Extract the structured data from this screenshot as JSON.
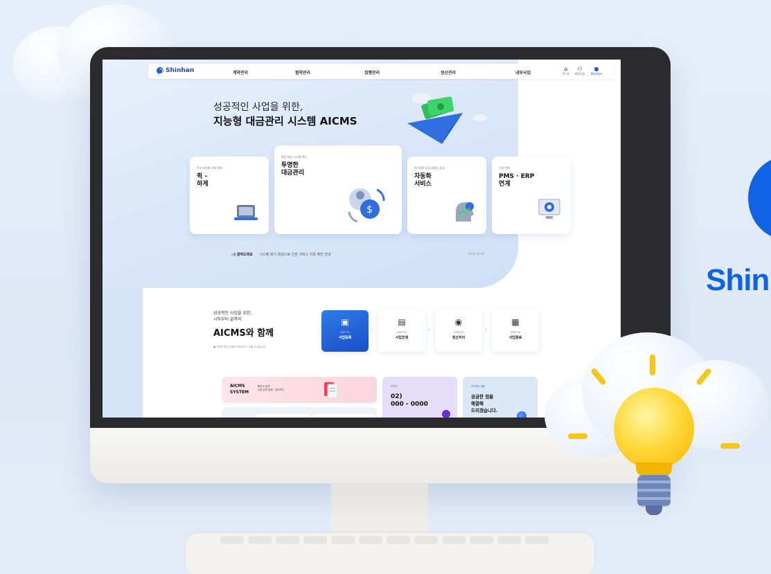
{
  "nav": {
    "logo": "Shinhan",
    "items": [
      "계약관리",
      "협약관리",
      "집행관리",
      "정산관리",
      "내부사업"
    ],
    "utils": [
      {
        "icon": "lock-icon",
        "label": "로그인"
      },
      {
        "icon": "user-icon",
        "label": "회원가입"
      },
      {
        "icon": "shinhan-logo-icon",
        "label": "Shinhan"
      }
    ]
  },
  "hero": {
    "line1": "성공적인 사업을 위한,",
    "line2": "지능형 대금관리 시스템 AICMS"
  },
  "cards": [
    {
      "sub": "문서 표준화 경영 절차",
      "title": "퀵 -\n하게",
      "icon": "laptop-icon"
    },
    {
      "sub": "통합 대금 시스템 관리",
      "title": "투명한\n대금관리",
      "icon": "payment-icon"
    },
    {
      "sub": "AI-OCR 도입 효율성 증대",
      "title": "자동화\n서비스",
      "icon": "ai-head-icon"
    },
    {
      "sub": "기관 연계",
      "title": "PMS · ERP\n연계",
      "icon": "monitor-icon"
    }
  ],
  "notice": {
    "label": "알려드려요",
    "text": "시스템 정기 점검으로 인한 서비스 이용 제한 안내",
    "date": "2022.08.20"
  },
  "section2": {
    "intro": "성공적인 사업을 위한,\n시작부터 끝까지",
    "title": "AICMS와 함께",
    "note": "● 기관에 따라 상세한 프로세스는 다를 수 있습니다."
  },
  "steps": [
    {
      "num": "STEP 01",
      "label": "사업등록",
      "icon": "clipboard-icon"
    },
    {
      "num": "STEP 02",
      "label": "사업진행",
      "icon": "doc-progress-icon"
    },
    {
      "num": "STEP 03",
      "label": "정산처리",
      "icon": "coins-icon"
    },
    {
      "num": "STEP 04",
      "label": "사업종료",
      "icon": "calendar-icon"
    }
  ],
  "aicms_box": {
    "title": "AICMS\nSYSTEM",
    "desc": "빠르고 쉽게\n신청 유의 집행 · 정산까지"
  },
  "contact": {
    "label": "문의처",
    "phone": "02)\n000 - 0000"
  },
  "faq": {
    "label": "자주하는 질문",
    "text": "궁금한 점을\n해결해\n드리겠습니다."
  },
  "brand": {
    "text": "Shinhan"
  }
}
